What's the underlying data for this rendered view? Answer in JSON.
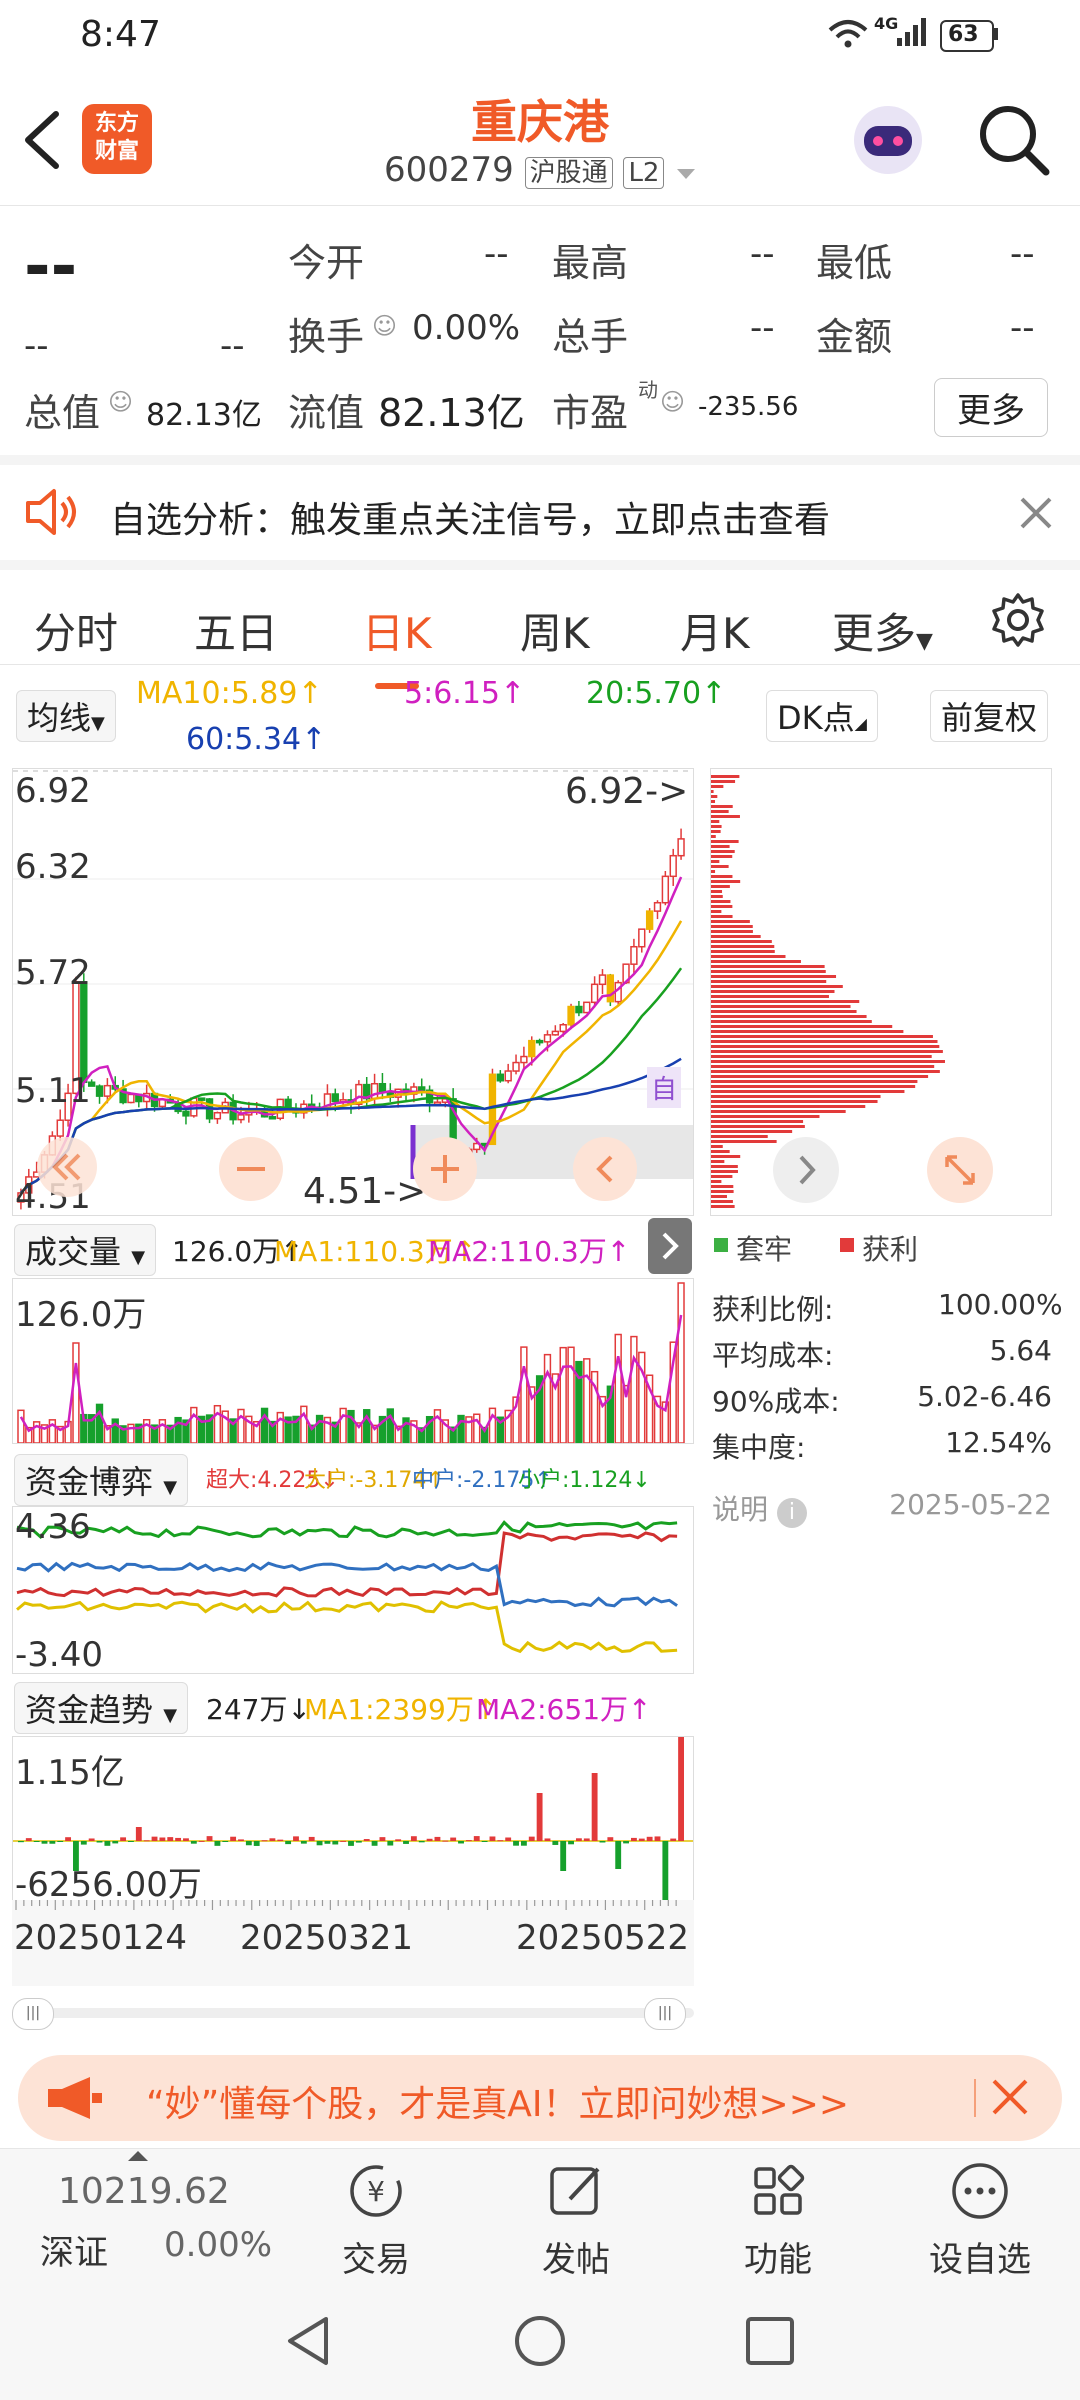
{
  "status_bar": {
    "time": "8:47",
    "network": "4G",
    "battery": "63"
  },
  "header": {
    "logo_line1": "东方",
    "logo_line2": "财富",
    "title": "重庆港",
    "code": "600279",
    "tag1": "沪股通",
    "tag2": "L2"
  },
  "quote": {
    "price": "--",
    "change": "--",
    "change_pct": "--",
    "open_label": "今开",
    "open": "--",
    "high_label": "最高",
    "high": "--",
    "low_label": "最低",
    "low": "--",
    "turnover_label": "换手",
    "turnover": "0.00%",
    "volume_label": "总手",
    "volume": "--",
    "amount_label": "金额",
    "amount": "--",
    "mktcap_label": "总值",
    "mktcap": "82.13亿",
    "float_label": "流值",
    "float_val": "82.13亿",
    "pe_label": "市盈",
    "pe_sup": "动",
    "pe": "-235.56",
    "more": "更多"
  },
  "notice": {
    "text": "自选分析：触发重点关注信号，立即点击查看"
  },
  "tabs": [
    {
      "label": "分时"
    },
    {
      "label": "五日"
    },
    {
      "label": "日K"
    },
    {
      "label": "周K"
    },
    {
      "label": "月K"
    },
    {
      "label": "更多"
    }
  ],
  "ma_row": {
    "selector": "均线",
    "ma10": "MA10:5.89↑",
    "ma5": "5:6.15↑",
    "ma20": "20:5.70↑",
    "ma60": "60:5.34↑",
    "dk": "DK点",
    "fq": "前复权"
  },
  "colors": {
    "accent": "#f05a28",
    "up": "#e23a3a",
    "down": "#16a02c",
    "ma5": "#d020c0",
    "ma10": "#f0b400",
    "ma20": "#18a020",
    "ma60": "#1840b0"
  },
  "kline": {
    "y_max": "6.92",
    "y_q1": "6.32",
    "y_mid": "5.72",
    "y_q3": "5.11",
    "y_min": "4.51",
    "max_label": "6.92->",
    "min_label": "4.51->",
    "auto": "自"
  },
  "volume": {
    "selector": "成交量",
    "value": "126.0万↑",
    "ma1": "MA1:110.3万↑",
    "ma2": "MA2:110.3万↑",
    "axis_max": "126.0万"
  },
  "fund_game": {
    "selector": "资金博弈",
    "super": "超大:4.225↓",
    "big": "大户:-3.174↑",
    "mid": "中户:-2.175↑",
    "small": "小户:1.124↓",
    "axis_max": "4.36",
    "axis_min": "-3.40"
  },
  "fund_trend": {
    "selector": "资金趋势",
    "value": "247万↓",
    "ma1": "MA1:2399万↑",
    "ma2": "MA2:651万↑",
    "axis_max": "1.15亿",
    "axis_min": "-6256.00万"
  },
  "dates": [
    "20250124",
    "20250321",
    "20250522"
  ],
  "chips": {
    "legend_trapped": "套牢",
    "legend_profit": "获利",
    "rows": [
      {
        "label": "获利比例:",
        "value": "100.00%"
      },
      {
        "label": "平均成本:",
        "value": "5.64"
      },
      {
        "label": "90%成本:",
        "value": "5.02-6.46"
      },
      {
        "label": "集中度:",
        "value": "12.54%"
      }
    ],
    "note_label": "说明",
    "date": "2025-05-22"
  },
  "ad": {
    "text": "“妙”懂每个股，才是真AI！立即问妙想>>>"
  },
  "bottom": {
    "index_value": "10219.62",
    "index_name": "深证",
    "index_pct": "0.00%",
    "trade": "交易",
    "post": "发帖",
    "func": "功能",
    "fav": "设自选"
  }
}
